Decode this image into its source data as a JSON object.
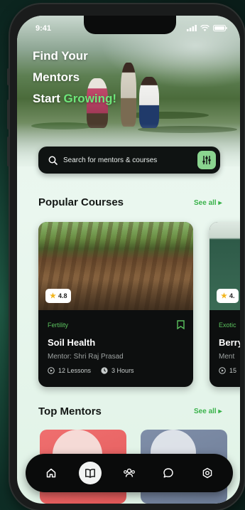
{
  "status_bar": {
    "time": "9:41"
  },
  "hero": {
    "line1": "Find Your",
    "line2": "Mentors",
    "line3_prefix": "Start ",
    "line3_accent": "Growing!",
    "accent_color": "#6ee67a"
  },
  "search": {
    "placeholder": "Search for mentors & courses",
    "icon": "search-icon",
    "filter_icon": "filter-sliders-icon"
  },
  "popular_courses": {
    "title": "Popular Courses",
    "see_all": "See all",
    "courses": [
      {
        "rating": "4.8",
        "category": "Fertility",
        "title": "Soil Health",
        "mentor": "Mentor: Shri Raj Prasad",
        "lessons": "12 Lessons",
        "duration": "3 Hours"
      },
      {
        "rating": "4.",
        "category": "Exotic",
        "title": "Berry",
        "mentor": "Ment",
        "lessons": "15"
      }
    ]
  },
  "top_mentors": {
    "title": "Top Mentors",
    "see_all": "See all"
  },
  "bottom_nav": {
    "items": [
      "home-icon",
      "book-icon",
      "community-icon",
      "chat-icon",
      "settings-icon"
    ],
    "active": "book-icon"
  },
  "colors": {
    "brand_green": "#39b24a",
    "card_bg": "#0d0f0f",
    "nav_bg": "#0a0b0b"
  }
}
